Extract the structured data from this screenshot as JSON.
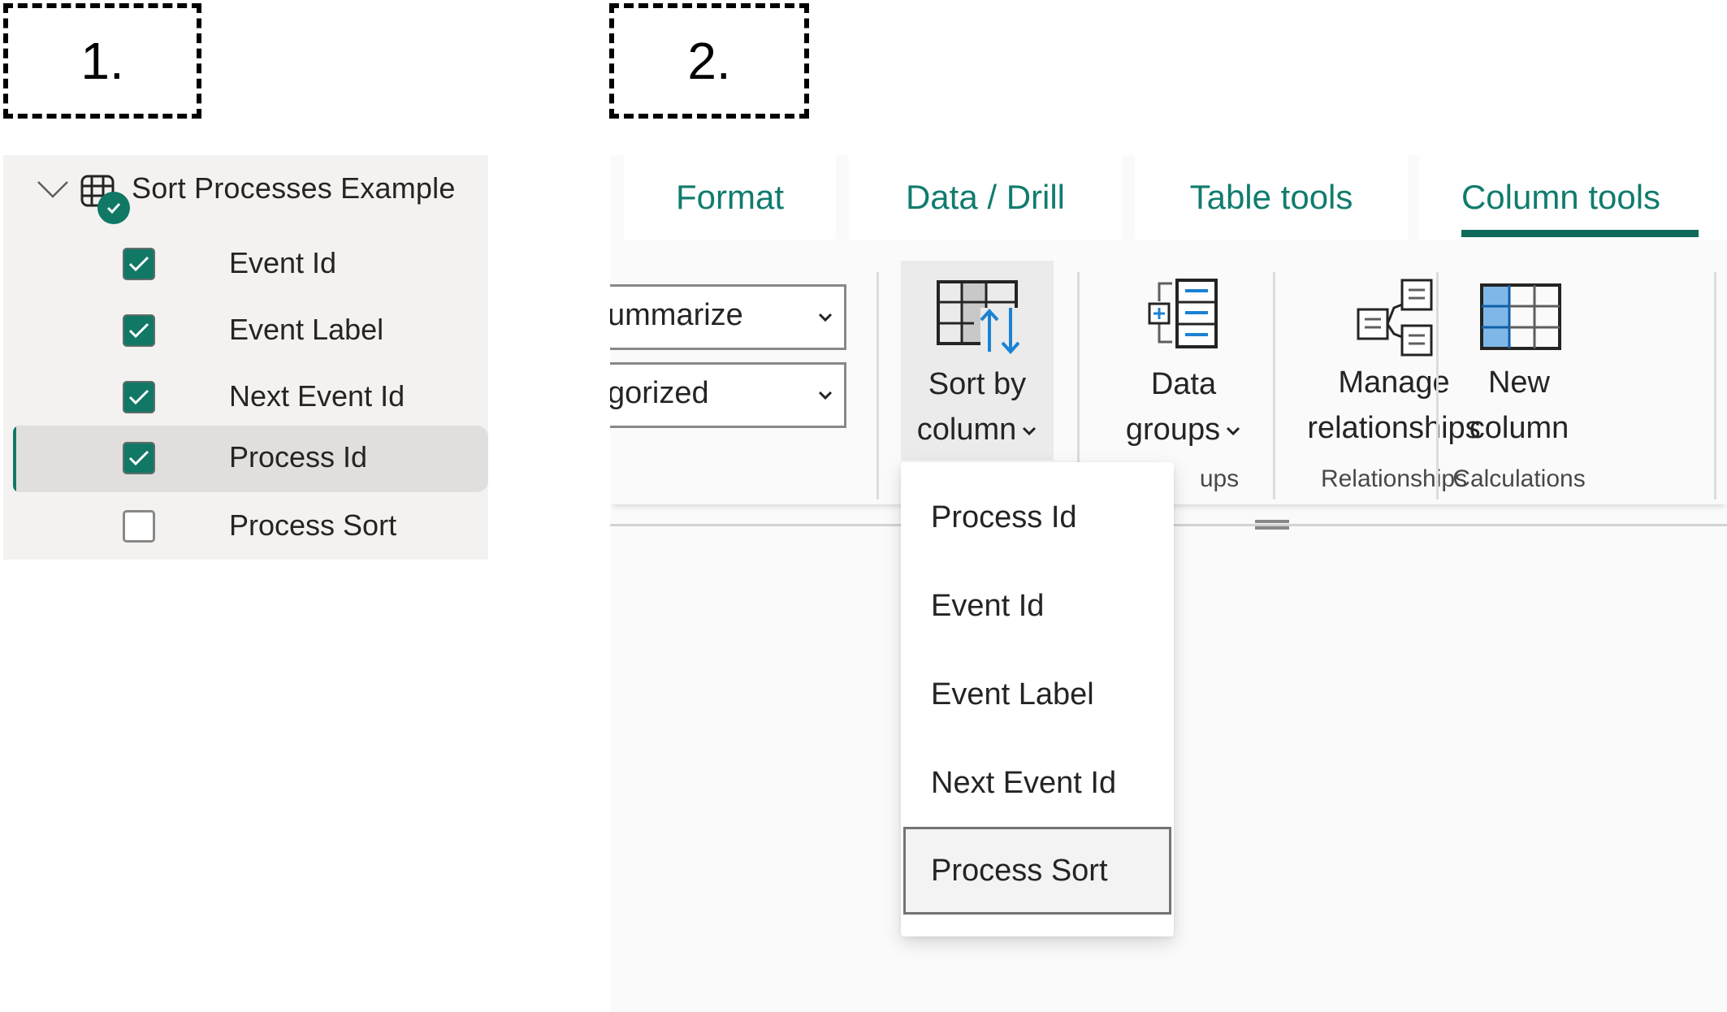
{
  "steps": {
    "step1": "1.",
    "step2": "2."
  },
  "field_list": {
    "table_name": "Sort Processes Example",
    "table_icon": "table-icon",
    "badge_icon": "checkmark-badge-icon",
    "expand_icon": "chevron-down-icon",
    "fields": [
      {
        "label": "Event Id",
        "checked": true,
        "selected": false
      },
      {
        "label": "Event Label",
        "checked": true,
        "selected": false
      },
      {
        "label": "Next Event Id",
        "checked": true,
        "selected": false
      },
      {
        "label": "Process Id",
        "checked": true,
        "selected": true
      },
      {
        "label": "Process Sort",
        "checked": false,
        "selected": false
      }
    ]
  },
  "ribbon": {
    "tabs": [
      {
        "label": "Format",
        "active": false
      },
      {
        "label": "Data / Drill",
        "active": false
      },
      {
        "label": "Table tools",
        "active": false
      },
      {
        "label": "Column tools",
        "active": true
      }
    ],
    "combos": [
      {
        "value": "ummarize"
      },
      {
        "value": "gorized"
      }
    ],
    "buttons": {
      "sort_by_column": {
        "line1": "Sort by",
        "line2": "column",
        "has_dropdown": true,
        "icon": "sort-by-column-icon"
      },
      "data_groups": {
        "line1": "Data",
        "line2": "groups",
        "has_dropdown": true,
        "icon": "data-groups-icon"
      },
      "manage_relationships": {
        "line1": "Manage",
        "line2": "relationships",
        "icon": "manage-relationships-icon"
      },
      "new_column": {
        "line1": "New",
        "line2": "column",
        "icon": "new-column-icon"
      }
    },
    "group_labels": {
      "groups": "ups",
      "relationships": "Relationships",
      "calculations": "Calculations"
    }
  },
  "sort_menu": {
    "items": [
      {
        "label": "Process Id",
        "focused": false
      },
      {
        "label": "Event Id",
        "focused": false
      },
      {
        "label": "Event Label",
        "focused": false
      },
      {
        "label": "Next Event Id",
        "focused": false
      },
      {
        "label": "Process Sort",
        "focused": true
      }
    ]
  },
  "colors": {
    "accent_teal": "#117865",
    "tab_text": "#107c6d",
    "icon_blue": "#1b82d3",
    "panel_bg": "#f3f2f1"
  }
}
